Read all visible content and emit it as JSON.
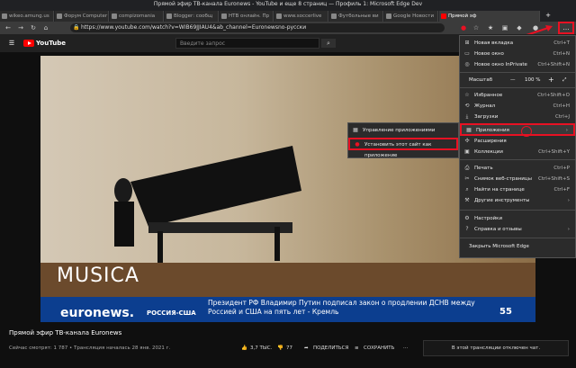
{
  "window": {
    "title": "Прямой эфир ТВ-канала Euronews - YouTube и еще 8 страниц — Профиль 1: Microsoft Edge Dev"
  },
  "tabs": [
    {
      "label": "wikeo.amung.us"
    },
    {
      "label": "Форум Computer"
    },
    {
      "label": "compizomania"
    },
    {
      "label": "Blogger: сообщ"
    },
    {
      "label": "НТВ онлайн. Пр"
    },
    {
      "label": "www.soccerlive"
    },
    {
      "label": "Футбольные ви"
    },
    {
      "label": "Google Новости"
    },
    {
      "label": "Прямой эф"
    }
  ],
  "address_bar": {
    "url": "https://www.youtube.com/watch?v=WIB69JJIAU4&ab_channel=Euronewsno-русски"
  },
  "youtube": {
    "logo_text": "YouTube",
    "search_placeholder": "Введите запрос"
  },
  "video": {
    "overlay_title": "MUSICA",
    "brand": "euronews.",
    "region": "РОССИЯ-США",
    "headline": "Президент РФ Владимир Путин подписал закон о продлении ДСНВ между Россией и США на пять лет - Кремль",
    "channel_number": "55"
  },
  "below_video": {
    "title": "Прямой эфир ТВ-канала Euronews",
    "meta": "Сейчас смотрят: 1 787 • Трансляция началась 28 янв. 2021 г.",
    "likes": "3,7 ТЫС.",
    "dislikes": "77",
    "share": "ПОДЕЛИТЬСЯ",
    "save": "СОХРАНИТЬ",
    "chat_disabled": "В этой трансляции отключен чат."
  },
  "menu": {
    "items": [
      {
        "label": "Новая вкладка",
        "shortcut": "Ctrl+T",
        "icon": "new-tab-icon"
      },
      {
        "label": "Новое окно",
        "shortcut": "Ctrl+N",
        "icon": "new-window-icon"
      },
      {
        "label": "Новое окно InPrivate",
        "shortcut": "Ctrl+Shift+N",
        "icon": "inprivate-icon"
      },
      {
        "label": "Масштаб",
        "zoom_minus": "—",
        "zoom_value": "100 %",
        "zoom_plus": "+"
      },
      {
        "label": "Избранное",
        "shortcut": "Ctrl+Shift+O",
        "icon": "favorites-icon"
      },
      {
        "label": "Журнал",
        "shortcut": "Ctrl+H",
        "icon": "history-icon"
      },
      {
        "label": "Загрузки",
        "shortcut": "Ctrl+J",
        "icon": "downloads-icon"
      },
      {
        "label": "Приложения",
        "shortcut": "",
        "icon": "apps-icon"
      },
      {
        "label": "Расширения",
        "shortcut": "",
        "icon": "extensions-icon"
      },
      {
        "label": "Коллекции",
        "shortcut": "Ctrl+Shift+Y",
        "icon": "collections-icon"
      },
      {
        "label": "Печать",
        "shortcut": "Ctrl+P",
        "icon": "print-icon"
      },
      {
        "label": "Снимок веб-страницы",
        "shortcut": "Ctrl+Shift+S",
        "icon": "screenshot-icon"
      },
      {
        "label": "Найти на странице",
        "shortcut": "Ctrl+F",
        "icon": "find-icon"
      },
      {
        "label": "Другие инструменты",
        "shortcut": "",
        "icon": "tools-icon"
      },
      {
        "label": "Настройки",
        "shortcut": "",
        "icon": "settings-icon"
      },
      {
        "label": "Справка и отзывы",
        "shortcut": "",
        "icon": "help-icon"
      },
      {
        "label": "Закрыть Microsoft Edge",
        "shortcut": "",
        "icon": ""
      }
    ]
  },
  "submenu": {
    "items": [
      {
        "label": "Управление приложениями"
      },
      {
        "label": "Установить этот сайт как приложение"
      }
    ]
  },
  "colors": {
    "highlight": "#e81123",
    "youtube_red": "#ff0000",
    "euronews_blue": "#0c3e8f"
  }
}
